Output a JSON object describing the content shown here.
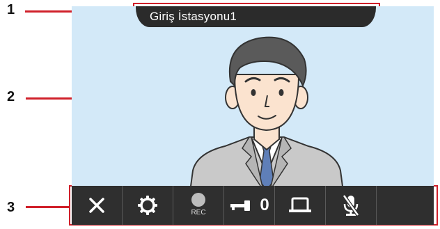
{
  "callouts": {
    "one": "1",
    "two": "2",
    "three": "3"
  },
  "screen": {
    "station_name": "Giriş İstasyonu1"
  },
  "toolbar": {
    "buttons": [
      {
        "icon": "close-icon"
      },
      {
        "icon": "gear-icon"
      },
      {
        "icon": "record-icon",
        "label": "REC"
      },
      {
        "icon": "key-icon",
        "label": "0"
      },
      {
        "icon": "monitor-icon"
      },
      {
        "icon": "mic-mute-icon"
      },
      {
        "icon": ""
      }
    ]
  }
}
